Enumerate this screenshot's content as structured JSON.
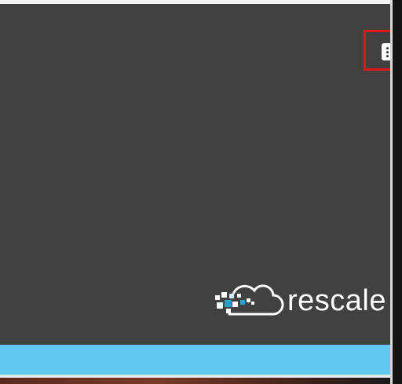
{
  "viewer": {
    "logo_text": "rescale",
    "menu_icon": "more-vertical-icon"
  },
  "colors": {
    "viewer_background": "#414141",
    "bottom_bar": "#5ec8ef",
    "highlight": "#e01818",
    "logo_accent": "#2aa1c9"
  }
}
